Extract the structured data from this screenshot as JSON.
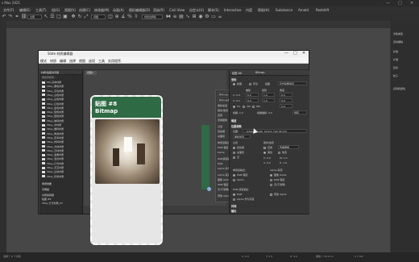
{
  "app": {
    "title": "s Max 2021",
    "controls": [
      "—",
      "□",
      "✕"
    ]
  },
  "menubar": {
    "items": [
      "文件(F)",
      "编辑(E)",
      "工具(T)",
      "组(G)",
      "视图(V)",
      "创建(C)",
      "修改器(M)",
      "动画(A)",
      "图形编辑器(D)",
      "渲染(R)",
      "Civil View",
      "自定义(U)",
      "脚本(S)",
      "Interactive",
      "内容",
      "帮助(H)",
      "Substance",
      "Arnold",
      "Redshift"
    ]
  },
  "toolbar": {
    "selection_filter": "全部",
    "view_select": "视图",
    "named_set": "创建选择集"
  },
  "command_panel": {
    "items": [
      "对象类型",
      "自动栅格",
      "标准",
      "扩展",
      "复合",
      "粒子",
      "名称和颜色"
    ]
  },
  "material_editor": {
    "title": "Slate 材质编辑器",
    "menu": [
      "模式",
      "材质",
      "编辑",
      "选择",
      "视图",
      "选项",
      "工具",
      "实用程序"
    ],
    "browser": {
      "header": "材质/贴图浏览器",
      "search": "按名称搜索...",
      "items": [
        "Mtl_基本材质",
        "VRay_黑色材质",
        "VRay_灰色材质",
        "VRay_白色材质",
        "VRay_白色材质",
        "VRay_红色材质",
        "VRay_金色材质",
        "VRay_铜色材质",
        "VRay_银色材质",
        "VRay_玻璃材质",
        "VRay_水材质",
        "VRay_塑料材质",
        "VRay_陶瓷材质",
        "VRay_皮革材质",
        "VRay_布料材质",
        "VRay_木纹材质",
        "VRay_石材材质",
        "VRay_金属材质",
        "VRay_混合材质",
        "VRay_灯光材质",
        "VRay_天空材质",
        "VRay_反射材质",
        "VRay_折射材质"
      ],
      "section_scene": "场景材质",
      "section_sample": "示例窗",
      "scene_items": [
        "材质编辑器",
        "贴图 #8",
        "VRay 灯光材质_01"
      ]
    },
    "view_tab": "视图1",
    "node": {
      "title": "贴图 #8",
      "subtitle": "Bitmap"
    },
    "navigator": [
      "Bitmap [位图]",
      "Bitmap参数",
      "重新加载",
      "裁剪/放置",
      "应用",
      "查看图像",
      "过滤",
      "四棱锥",
      "总面积",
      "单通道输出",
      "RGB 强度",
      "Alpha",
      "RGB通道输出",
      "RGB",
      "Alpha 作为灰度",
      "Alpha 来源",
      "图像 Alpha",
      "RGB 强度",
      "无(不透明)",
      "预乘 Alpha"
    ],
    "params": {
      "header_title": "贴图 #8",
      "header_type": "Bitmap",
      "coords_title": "坐标",
      "coords": [
        "纹理",
        "环境",
        "贴图",
        "显式贴图通道"
      ],
      "uvw": [
        "UV",
        "VW",
        "WU"
      ],
      "offset_label": "偏移",
      "tiling_label": "瓷砖",
      "angle_label": "角度",
      "offset": [
        "0.0",
        "0.0"
      ],
      "tiling": [
        "1.0",
        "1.0"
      ],
      "angle": [
        "0.0",
        "0.0",
        "0.0"
      ],
      "blur": "模糊: 1.0",
      "blur_offset": "模糊偏移: 0.0",
      "rotate": "旋转",
      "noise_title": "噪波",
      "bitmap_title": "位图参数",
      "bitmap_path": "...\\photo_studio_london_hall_8k.hdr",
      "bitmap_label": "位图:",
      "reload": "重新加载",
      "filter_title": "过滤",
      "filter": [
        "四棱锥",
        "总面积",
        "无"
      ],
      "crop_title": "裁剪/放置",
      "apply": "应用",
      "view_image": "查看图像",
      "crop": [
        "裁剪",
        "放置"
      ],
      "single_output": "单通道输出:",
      "single": [
        "RGB 强度",
        "Alpha"
      ],
      "alpha_source": "Alpha 来源",
      "alpha": [
        "图像 Alpha",
        "RGB 强度",
        "无(不透明)"
      ],
      "rgb_output": "RGB 通道输出:",
      "rgb": [
        "RGB",
        "Alpha 作为灰度"
      ],
      "premult": "预乘 Alpha",
      "time": "时间",
      "output": "输出",
      "uvw_values": [
        "U: 0.0",
        "V: 0.0",
        "W: 1.0",
        "H: 1.0"
      ]
    }
  },
  "status": {
    "text": "选择了 0 个对象",
    "coords": [
      "X: 0.0",
      "Y: 0.0",
      "Z: 0.0"
    ],
    "grid": "栅格 = 10.0cm",
    "time": "0 / 100"
  }
}
